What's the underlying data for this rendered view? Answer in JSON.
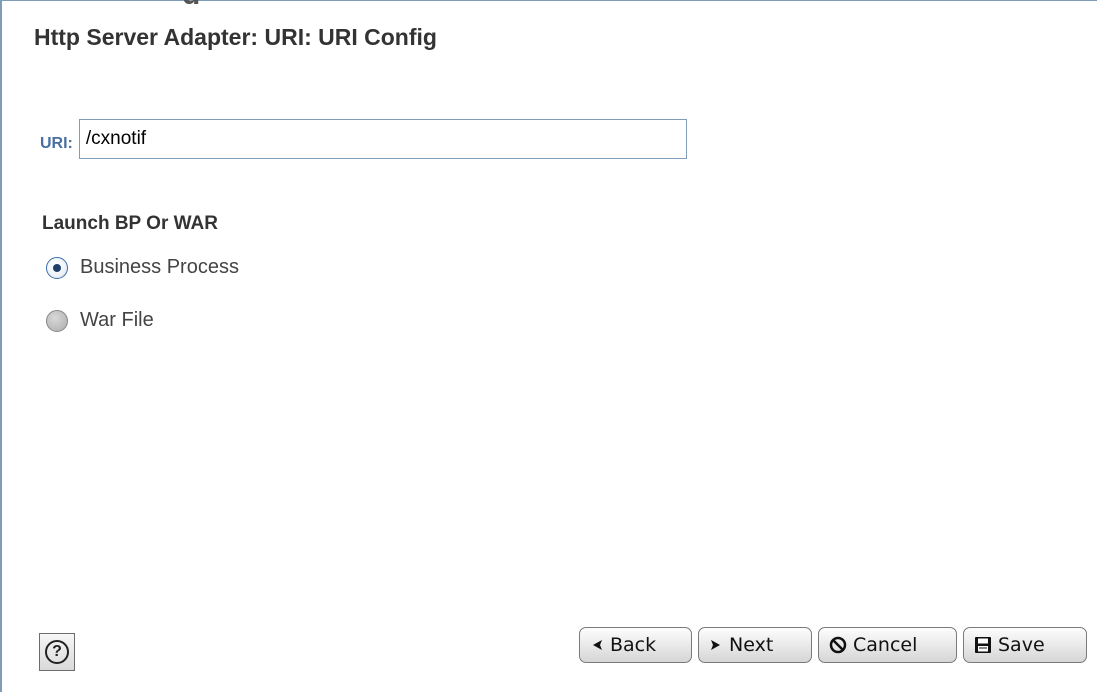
{
  "dialog": {
    "title": "Http Server Adapter: URI: URI Config"
  },
  "uri": {
    "label": "URI:",
    "value": "/cxnotif"
  },
  "launch": {
    "heading": "Launch BP Or WAR",
    "options": [
      {
        "label": "Business Process",
        "selected": true
      },
      {
        "label": "War File",
        "selected": false
      }
    ]
  },
  "buttons": {
    "back": "Back",
    "next": "Next",
    "cancel": "Cancel",
    "save": "Save"
  },
  "icons": {
    "help": "help-icon",
    "back": "back-arrow-icon",
    "next": "next-arrow-icon",
    "cancel": "cancel-icon",
    "save": "save-disk-icon"
  },
  "colors": {
    "border": "#7f9db9",
    "label_blue": "#4a6fa0",
    "radio_checked": "#3c6ea5"
  }
}
